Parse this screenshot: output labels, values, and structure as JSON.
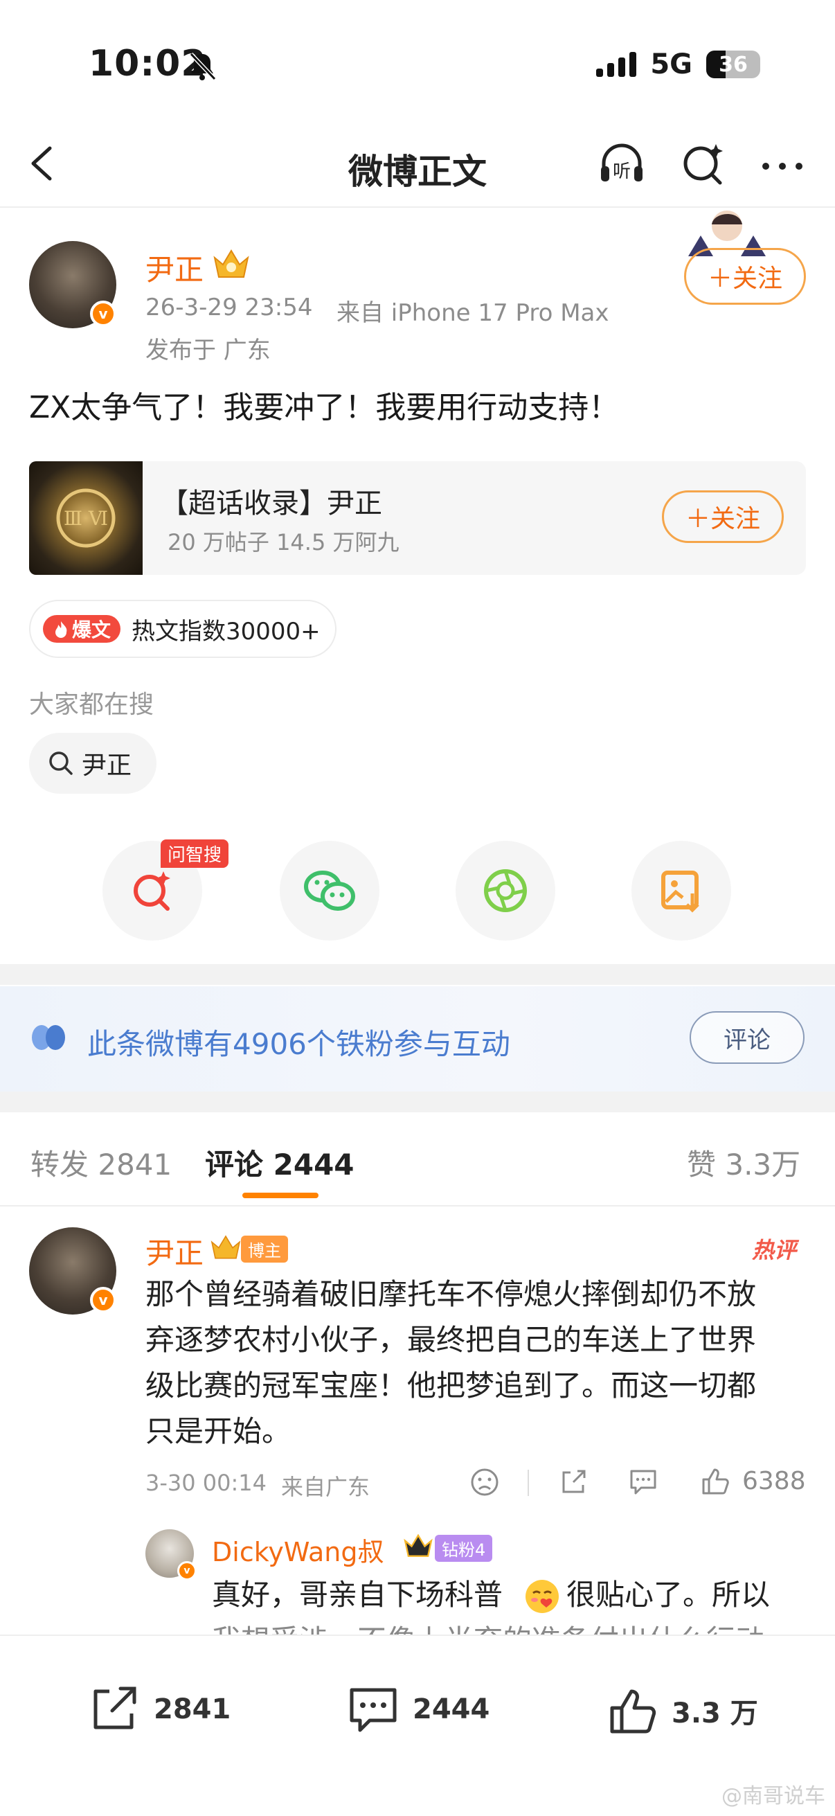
{
  "status_bar": {
    "time": "10:02",
    "network": "5G",
    "battery": "36"
  },
  "nav": {
    "title": "微博正文"
  },
  "post": {
    "author": "尹正",
    "timestamp": "26-3-29 23:54",
    "source": "来自 iPhone 17 Pro Max",
    "location": "发布于 广东",
    "follow_label": "＋关注",
    "content": "ZX太争气了！我要冲了！我要用行动支持！"
  },
  "topic_card": {
    "title": "【超话收录】尹正",
    "stats": "20 万帖子  14.5 万阿九",
    "follow_label": "＋关注"
  },
  "hot": {
    "tag": "爆文",
    "text": "热文指数30000+"
  },
  "search": {
    "label": "大家都在搜",
    "chip": "尹正"
  },
  "share": {
    "ask_badge": "问智搜"
  },
  "fans": {
    "text": "此条微博有4906个铁粉参与互动",
    "button": "评论"
  },
  "tabs": {
    "repost": "转发 2841",
    "comment": "评论 2444",
    "like": "赞 3.3万"
  },
  "comments": [
    {
      "author": "尹正",
      "badge": "博主",
      "hot_label": "热评",
      "text_lines": [
        "那个曾经骑着破旧摩托车不停熄火摔倒却仍不放",
        "弃逐梦农村小伙子，最终把自己的车送上了世界",
        "级比赛的冠军宝座！他把梦追到了。而这一切都",
        "只是开始。"
      ],
      "time": "3-30 00:14",
      "location": "来自广东",
      "likes": "6388"
    }
  ],
  "reply": {
    "author": "DickyWang叔",
    "badge": "钻粉4",
    "text_line1a": "真好，哥亲自下场科普",
    "text_line1b": "很贴心了。所以",
    "text_line2": "我想受涉，不像上半弃的准备付出什么行动"
  },
  "bottom_bar": {
    "repost": "2841",
    "comment": "2444",
    "like": "3.3 万"
  },
  "watermark": "@南哥说车",
  "colors": {
    "brand_orange": "#ff8200",
    "username": "#f26a12",
    "link_blue": "#4a7ccf"
  }
}
